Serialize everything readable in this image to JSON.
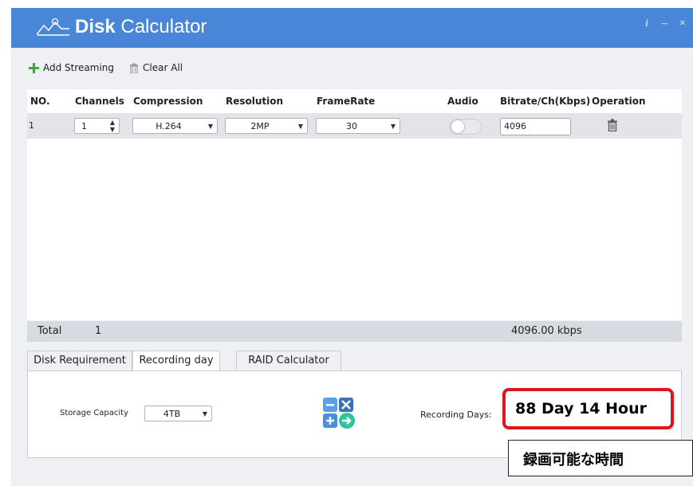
{
  "app": {
    "title_bold": "Disk",
    "title_rest": " Calculator",
    "info_label": "i",
    "minimize_label": "–",
    "close_label": "×"
  },
  "toolbar": {
    "add_label": "Add Streaming",
    "clear_label": "Clear All"
  },
  "table": {
    "columns": [
      "NO.",
      "Channels",
      "Compression",
      "Resolution",
      "FrameRate",
      "Audio",
      "Bitrate/Ch(Kbps)",
      "Operation"
    ],
    "rows": [
      {
        "no": "1",
        "channels": "1",
        "compression": "H.264",
        "resolution": "2MP",
        "framerate": "30",
        "audio_on": false,
        "bitrate": "4096"
      }
    ]
  },
  "total": {
    "label": "Total",
    "channels": "1",
    "bitrate": "4096.00 kbps"
  },
  "tabs": [
    {
      "label": "Disk Requirement",
      "active": false
    },
    {
      "label": "Recording day",
      "active": true
    },
    {
      "label": "RAID Calculator",
      "active": false
    }
  ],
  "recording": {
    "storage_label": "Storage Capacity",
    "storage_value": "4TB",
    "days_label": "Recording Days:",
    "days_value": "88 Day 14 Hour"
  },
  "annotation": {
    "note": "録画可能な時間"
  },
  "colors": {
    "titlebar": "#4a86d8",
    "add_icon": "#3aaa35",
    "highlight_border": "#e0141c"
  }
}
